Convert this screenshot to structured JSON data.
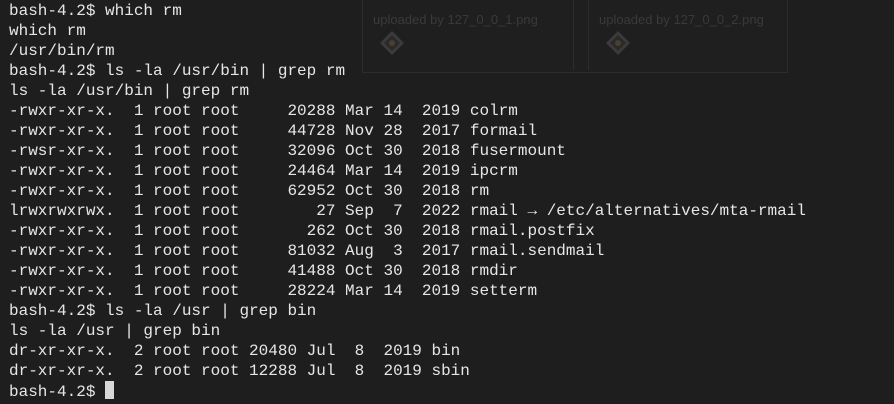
{
  "ghost_uploads": [
    {
      "label": "uploaded by 127_0_0_1.png"
    },
    {
      "label": "uploaded by 127_0_0_2.png"
    }
  ],
  "terminal": {
    "lines": [
      "bash-4.2$ which rm",
      "which rm",
      "/usr/bin/rm",
      "bash-4.2$ ls -la /usr/bin | grep rm",
      "ls -la /usr/bin | grep rm",
      "-rwxr-xr-x.  1 root root     20288 Mar 14  2019 colrm",
      "-rwxr-xr-x.  1 root root     44728 Nov 28  2017 formail",
      "-rwsr-xr-x.  1 root root     32096 Oct 30  2018 fusermount",
      "-rwxr-xr-x.  1 root root     24464 Mar 14  2019 ipcrm",
      "-rwxr-xr-x.  1 root root     62952 Oct 30  2018 rm",
      "lrwxrwxrwx.  1 root root        27 Sep  7  2022 rmail → /etc/alternatives/mta-rmail",
      "-rwxr-xr-x.  1 root root       262 Oct 30  2018 rmail.postfix",
      "-rwxr-xr-x.  1 root root     81032 Aug  3  2017 rmail.sendmail",
      "-rwxr-xr-x.  1 root root     41488 Oct 30  2018 rmdir",
      "-rwxr-xr-x.  1 root root     28224 Mar 14  2019 setterm",
      "bash-4.2$ ls -la /usr | grep bin",
      "ls -la /usr | grep bin",
      "dr-xr-xr-x.  2 root root 20480 Jul  8  2019 bin",
      "dr-xr-xr-x.  2 root root 12288 Jul  8  2019 sbin"
    ],
    "prompt": "bash-4.2$ "
  },
  "colors": {
    "background": "#1e1e1e",
    "text": "#e6e6e6",
    "cursor": "#d8d8d8"
  }
}
